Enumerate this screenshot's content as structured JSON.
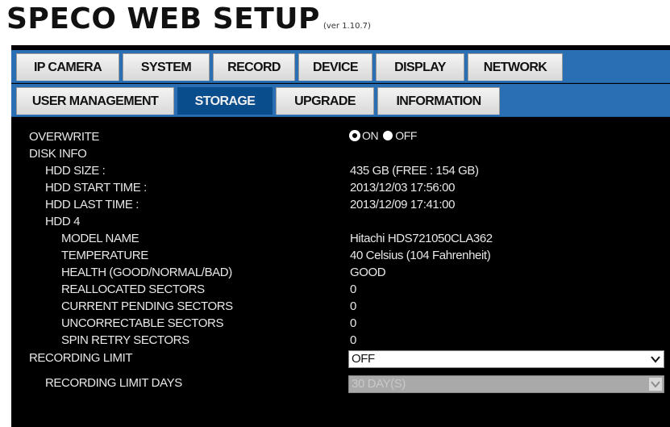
{
  "header": {
    "title": "SPECO WEB SETUP",
    "version": "(ver 1.10.7)"
  },
  "tabs_row1": [
    "IP CAMERA",
    "SYSTEM",
    "RECORD",
    "DEVICE",
    "DISPLAY",
    "NETWORK"
  ],
  "tabs_row2": [
    "USER MANAGEMENT",
    "STORAGE",
    "UPGRADE",
    "INFORMATION"
  ],
  "active_tab": "STORAGE",
  "overwrite": {
    "label": "OVERWRITE",
    "options": [
      "ON",
      "OFF"
    ],
    "selected": "ON"
  },
  "disk_info": {
    "label": "DISK INFO",
    "hdd_size_label": "HDD SIZE :",
    "hdd_size_value": "435 GB (FREE : 154 GB)",
    "start_time_label": "HDD START TIME :",
    "start_time_value": "2013/12/03 17:56:00",
    "last_time_label": "HDD LAST TIME :",
    "last_time_value": "2013/12/09 17:41:00",
    "hdd_label": "HDD 4",
    "model_label": "MODEL NAME",
    "model_value": "Hitachi HDS721050CLA362",
    "temp_label": "TEMPERATURE",
    "temp_value": "40 Celsius (104 Fahrenheit)",
    "health_label": "HEALTH (GOOD/NORMAL/BAD)",
    "health_value": "GOOD",
    "realloc_label": "REALLOCATED SECTORS",
    "realloc_value": "0",
    "pending_label": "CURRENT PENDING SECTORS",
    "pending_value": "0",
    "uncorrectable_label": "UNCORRECTABLE SECTORS",
    "uncorrectable_value": "0",
    "spin_label": "SPIN RETRY SECTORS",
    "spin_value": "0"
  },
  "recording_limit": {
    "label": "RECORDING LIMIT",
    "value": "OFF"
  },
  "recording_limit_days": {
    "label": "RECORDING LIMIT DAYS",
    "value": "30 DAY(S)"
  }
}
